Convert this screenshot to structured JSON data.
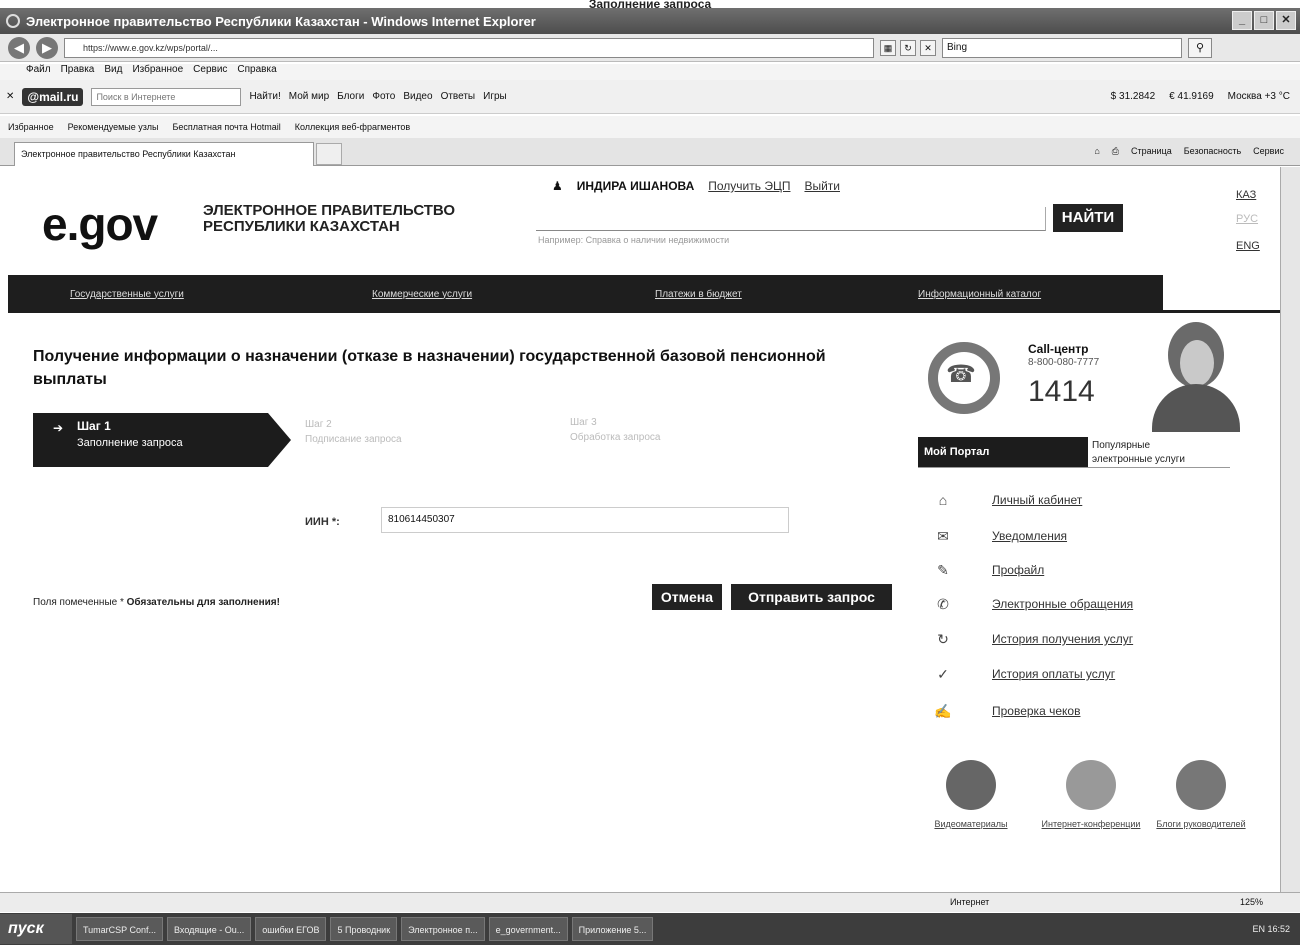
{
  "doc_caption": "Заполнение запроса",
  "window": {
    "title": "Электронное правительство Республики Казахстан - Windows Internet Explorer",
    "address": "https://www.e.gov.kz/wps/portal/...",
    "bing_label": "Bing"
  },
  "menubar": [
    "Файл",
    "Правка",
    "Вид",
    "Избранное",
    "Сервис",
    "Справка"
  ],
  "mailbar": {
    "brand": "@mail.ru",
    "search_placeholder": "Поиск в Интернете",
    "find": "Найти!",
    "links": [
      "Мой мир",
      "Блоги",
      "Фото",
      "Видео",
      "Ответы",
      "Игры"
    ],
    "usd": "$ 31.2842",
    "eur": "€ 41.9169",
    "weather": "Москва +3 °C"
  },
  "favbar": {
    "favorites": "Избранное",
    "items": [
      "Рекомендуемые узлы",
      "Бесплатная почта Hotmail",
      "Коллекция веб-фрагментов"
    ]
  },
  "tab": {
    "title": "Электронное правительство Республики Казахстан"
  },
  "cmdbar": [
    "Страница",
    "Безопасность",
    "Сервис"
  ],
  "site": {
    "logo": "e.gov",
    "logo_line1": "ЭЛЕКТРОННОЕ ПРАВИТЕЛЬСТВО",
    "logo_line2": "РЕСПУБЛИКИ КАЗАХСТАН",
    "user_name": "ИНДИРА ИШАНОВА",
    "get_ecp": "Получить ЭЦП",
    "logout": "Выйти",
    "search_hint": "Например: Справка о наличии недвижимости",
    "search_btn": "НАЙТИ",
    "lang": [
      "КАЗ",
      "РУС",
      "ENG"
    ]
  },
  "nav": [
    "Государственные услуги",
    "Коммерческие услуги",
    "Платежи в бюджет",
    "Информационный каталог"
  ],
  "page": {
    "title": "Получение информации о назначении (отказе в назначении) государственной базовой пенсионной выплаты",
    "steps": [
      {
        "name": "Шаг 1",
        "desc": "Заполнение запроса"
      },
      {
        "name": "Шаг 2",
        "desc": "Подписание запроса"
      },
      {
        "name": "Шаг 3",
        "desc": "Обработка запроса"
      }
    ],
    "iin_label": "ИИН *:",
    "iin_value": "810614450307",
    "required_prefix": "Поля помеченные * ",
    "required_bold": "Обязательны для заполнения!",
    "cancel": "Отмена",
    "submit": "Отправить запрос"
  },
  "sidebar": {
    "call_title": "Call-центр",
    "call_phone": "8-800-080-7777",
    "call_short": "1414",
    "portal_tab": "Мой Портал",
    "popular_line1": "Популярные",
    "popular_line2": "электронные услуги",
    "menu": [
      {
        "label": "Личный кабинет",
        "icon": "home-icon"
      },
      {
        "label": "Уведомления",
        "icon": "notification-icon"
      },
      {
        "label": "Профайл",
        "icon": "profile-icon"
      },
      {
        "label": "Электронные обращения",
        "icon": "appeal-icon"
      },
      {
        "label": "История получения услуг",
        "icon": "history-icon"
      },
      {
        "label": "История оплаты услуг",
        "icon": "payment-icon"
      },
      {
        "label": "Проверка чеков",
        "icon": "check-icon"
      }
    ],
    "media": [
      {
        "label": "Видеоматериалы",
        "icon": "film-reel-icon"
      },
      {
        "label": "Интернет-конференции",
        "icon": "conference-icon"
      },
      {
        "label": "Блоги руководителей",
        "icon": "blog-icon"
      }
    ]
  },
  "statusbar": {
    "zone": "Интернет",
    "zoom": "125%"
  },
  "taskbar": {
    "start": "пуск",
    "items": [
      "TumarCSP Conf...",
      "Входящие - Ou...",
      "ошибки ЕГОВ",
      "5 Проводник",
      "Электронное п...",
      "e_government...",
      "Приложение 5..."
    ],
    "tray": "EN  16:52"
  }
}
